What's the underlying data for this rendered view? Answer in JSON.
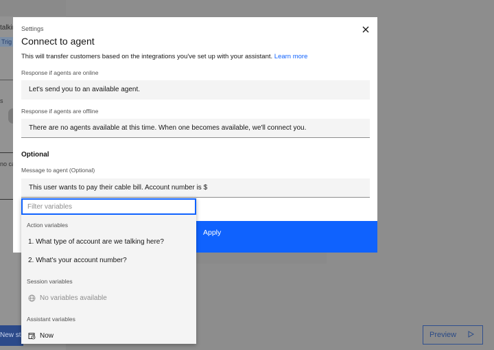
{
  "background": {
    "left_panel_text": "talkin",
    "left_panel_tag": "Trig",
    "left_panel_mark": "s",
    "left_panel_text2": "no ca",
    "new_step_label": "New st",
    "preview_label": "Preview"
  },
  "modal": {
    "label": "Settings",
    "title": "Connect to agent",
    "description": "This will transfer customers based on the integrations you've set up with your assistant.",
    "learn_more": "Learn more",
    "online_label": "Response if agents are online",
    "online_value": "Let's send you to an available agent.",
    "offline_label": "Response if agents are offline",
    "offline_value": "There are no agents available at this time. When one becomes available, we'll connect you.",
    "optional_heading": "Optional",
    "message_label": "Message to agent (Optional)",
    "message_value": "This user wants to pay their cable bill. Account number is $",
    "apply_label": "Apply"
  },
  "dropdown": {
    "filter_placeholder": "Filter variables",
    "action_heading": "Action variables",
    "action_items": [
      "1. What type of account are we talking here?",
      "2. What's your account number?"
    ],
    "session_heading": "Session variables",
    "session_empty": "No variables available",
    "assistant_heading": "Assistant variables",
    "assistant_items": [
      "Now"
    ]
  },
  "colors": {
    "accent": "#0f62fe",
    "overlay": "#8d8d8d"
  }
}
